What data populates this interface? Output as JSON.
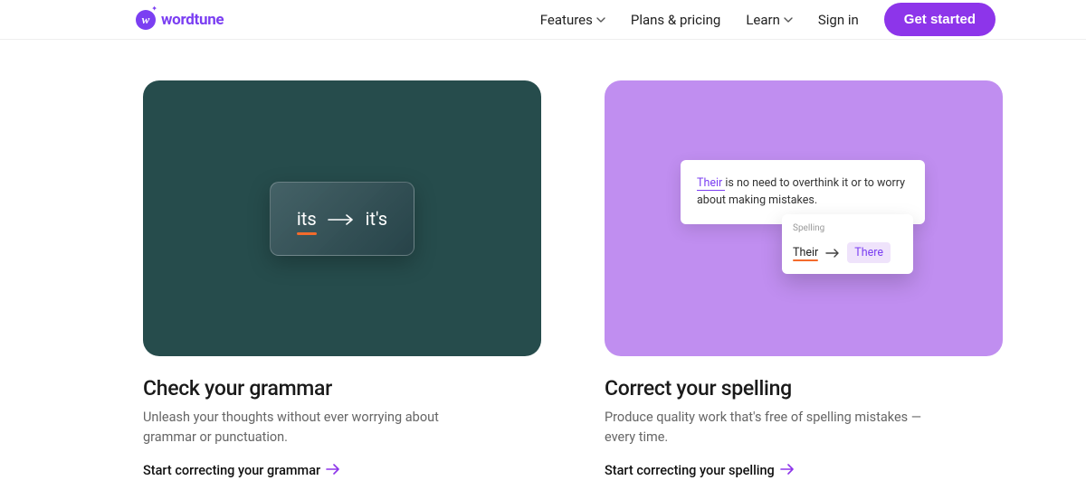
{
  "header": {
    "brand": "wordtune",
    "nav": {
      "features": "Features",
      "plans": "Plans & pricing",
      "learn": "Learn",
      "signin": "Sign in"
    },
    "cta": "Get started"
  },
  "cards": {
    "grammar": {
      "tile": {
        "from": "its",
        "to": "it's"
      },
      "title": "Check your grammar",
      "desc": "Unleash your thoughts without ever worrying about grammar or punctuation.",
      "link": "Start correcting your grammar"
    },
    "spelling": {
      "tile": {
        "sentence_prefix": "Their",
        "sentence_rest": " is no need to overthink it or to worry about making mistakes.",
        "popup_label": "Spelling",
        "wrong": "Their",
        "right": "There"
      },
      "title": "Correct your spelling",
      "desc": "Produce quality work that's free of spelling mistakes — every time.",
      "link": "Start correcting your spelling"
    }
  }
}
